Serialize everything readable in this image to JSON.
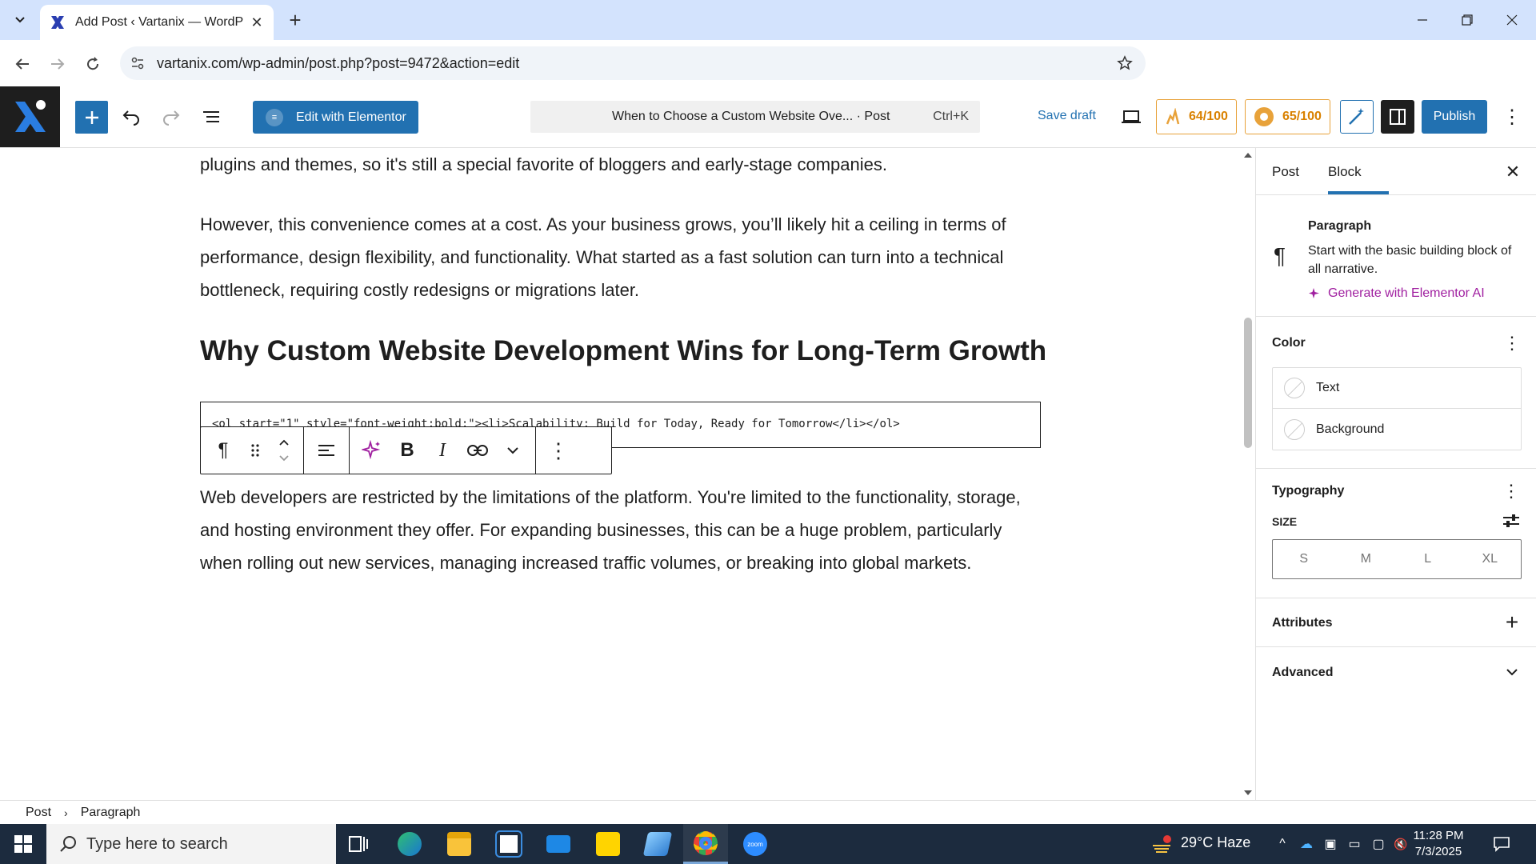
{
  "browser": {
    "tab_title": "Add Post ‹ Vartanix — WordPre",
    "url": "vartanix.com/wp-admin/post.php?post=9472&action=edit"
  },
  "header": {
    "elementor_label": "Edit with Elementor",
    "doc_title": "When to Choose a Custom Website Ove... · Post",
    "shortcut": "Ctrl+K",
    "save_draft": "Save draft",
    "score1": "64/100",
    "score2": "65/100",
    "publish": "Publish"
  },
  "content": {
    "para1": "plugins and themes, so it's still a special favorite of bloggers and early-stage companies.",
    "para2": "However, this convenience comes at a cost. As your business grows, you’ll likely hit a ceiling in terms of performance, design flexibility, and functionality. What started as a fast solution can turn into a technical bottleneck, requiring costly redesigns or migrations later.",
    "heading": "Why Custom Website Development Wins for Long-Term Growth",
    "code": "<ol start=\"1\" style=\"font-weight:bold;\"><li>Scalability: Build for Today, Ready for Tomorrow</li></ol>",
    "para3": "Web developers are restricted by the limitations of the platform. You're limited to the functionality, storage, and hosting environment they offer. For expanding businesses, this can be a huge problem, particularly when rolling out new services, managing increased traffic volumes, or breaking into global markets."
  },
  "sidebar": {
    "tab_post": "Post",
    "tab_block": "Block",
    "block_title": "Paragraph",
    "block_desc": "Start with the basic building block of all narrative.",
    "ai_link": "Generate with Elementor AI",
    "color_title": "Color",
    "color_text": "Text",
    "color_background": "Background",
    "typography_title": "Typography",
    "size_label": "SIZE",
    "sizes": [
      "S",
      "M",
      "L",
      "XL"
    ],
    "attributes_title": "Attributes",
    "advanced_title": "Advanced"
  },
  "breadcrumb": {
    "root": "Post",
    "current": "Paragraph"
  },
  "taskbar": {
    "search_placeholder": "Type here to search",
    "weather": "29°C  Haze",
    "time": "11:28 PM",
    "date": "7/3/2025"
  },
  "colors": {
    "accent": "#2271b1",
    "score": "#d98100",
    "ai": "#a020a0",
    "taskbar": "#1c2b3e"
  }
}
